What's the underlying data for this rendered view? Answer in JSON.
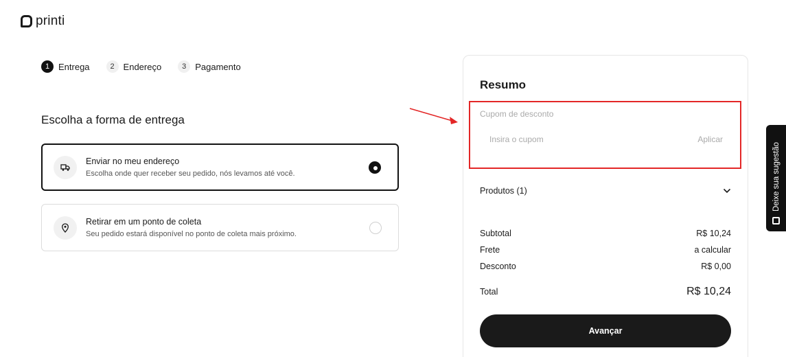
{
  "brand": {
    "name": "printi"
  },
  "steps": [
    {
      "num": "1",
      "label": "Entrega",
      "active": true
    },
    {
      "num": "2",
      "label": "Endereço",
      "active": false
    },
    {
      "num": "3",
      "label": "Pagamento",
      "active": false
    }
  ],
  "delivery": {
    "title": "Escolha a forma de entrega",
    "options": [
      {
        "title": "Enviar no meu endereço",
        "subtitle": "Escolha onde quer receber seu pedido, nós levamos até você.",
        "icon": "truck-icon",
        "selected": true
      },
      {
        "title": "Retirar em um ponto de coleta",
        "subtitle": "Seu pedido estará disponível no ponto de coleta mais próximo.",
        "icon": "location-pin-icon",
        "selected": false
      }
    ]
  },
  "summary": {
    "title": "Resumo",
    "coupon": {
      "label": "Cupom de desconto",
      "placeholder": "Insira o cupom",
      "value": "",
      "apply_label": "Aplicar"
    },
    "products_label": "Produtos (1)",
    "rows": [
      {
        "label": "Subtotal",
        "value": "R$ 10,24"
      },
      {
        "label": "Frete",
        "value": "a calcular"
      },
      {
        "label": "Desconto",
        "value": "R$ 0,00"
      }
    ],
    "total": {
      "label": "Total",
      "value": "R$ 10,24"
    },
    "advance_label": "Avançar"
  },
  "feedback": {
    "label": "Deixe sua sugestão",
    "icon": "feedback-icon"
  },
  "colors": {
    "accent": "#111111",
    "highlight": "#e32626"
  }
}
